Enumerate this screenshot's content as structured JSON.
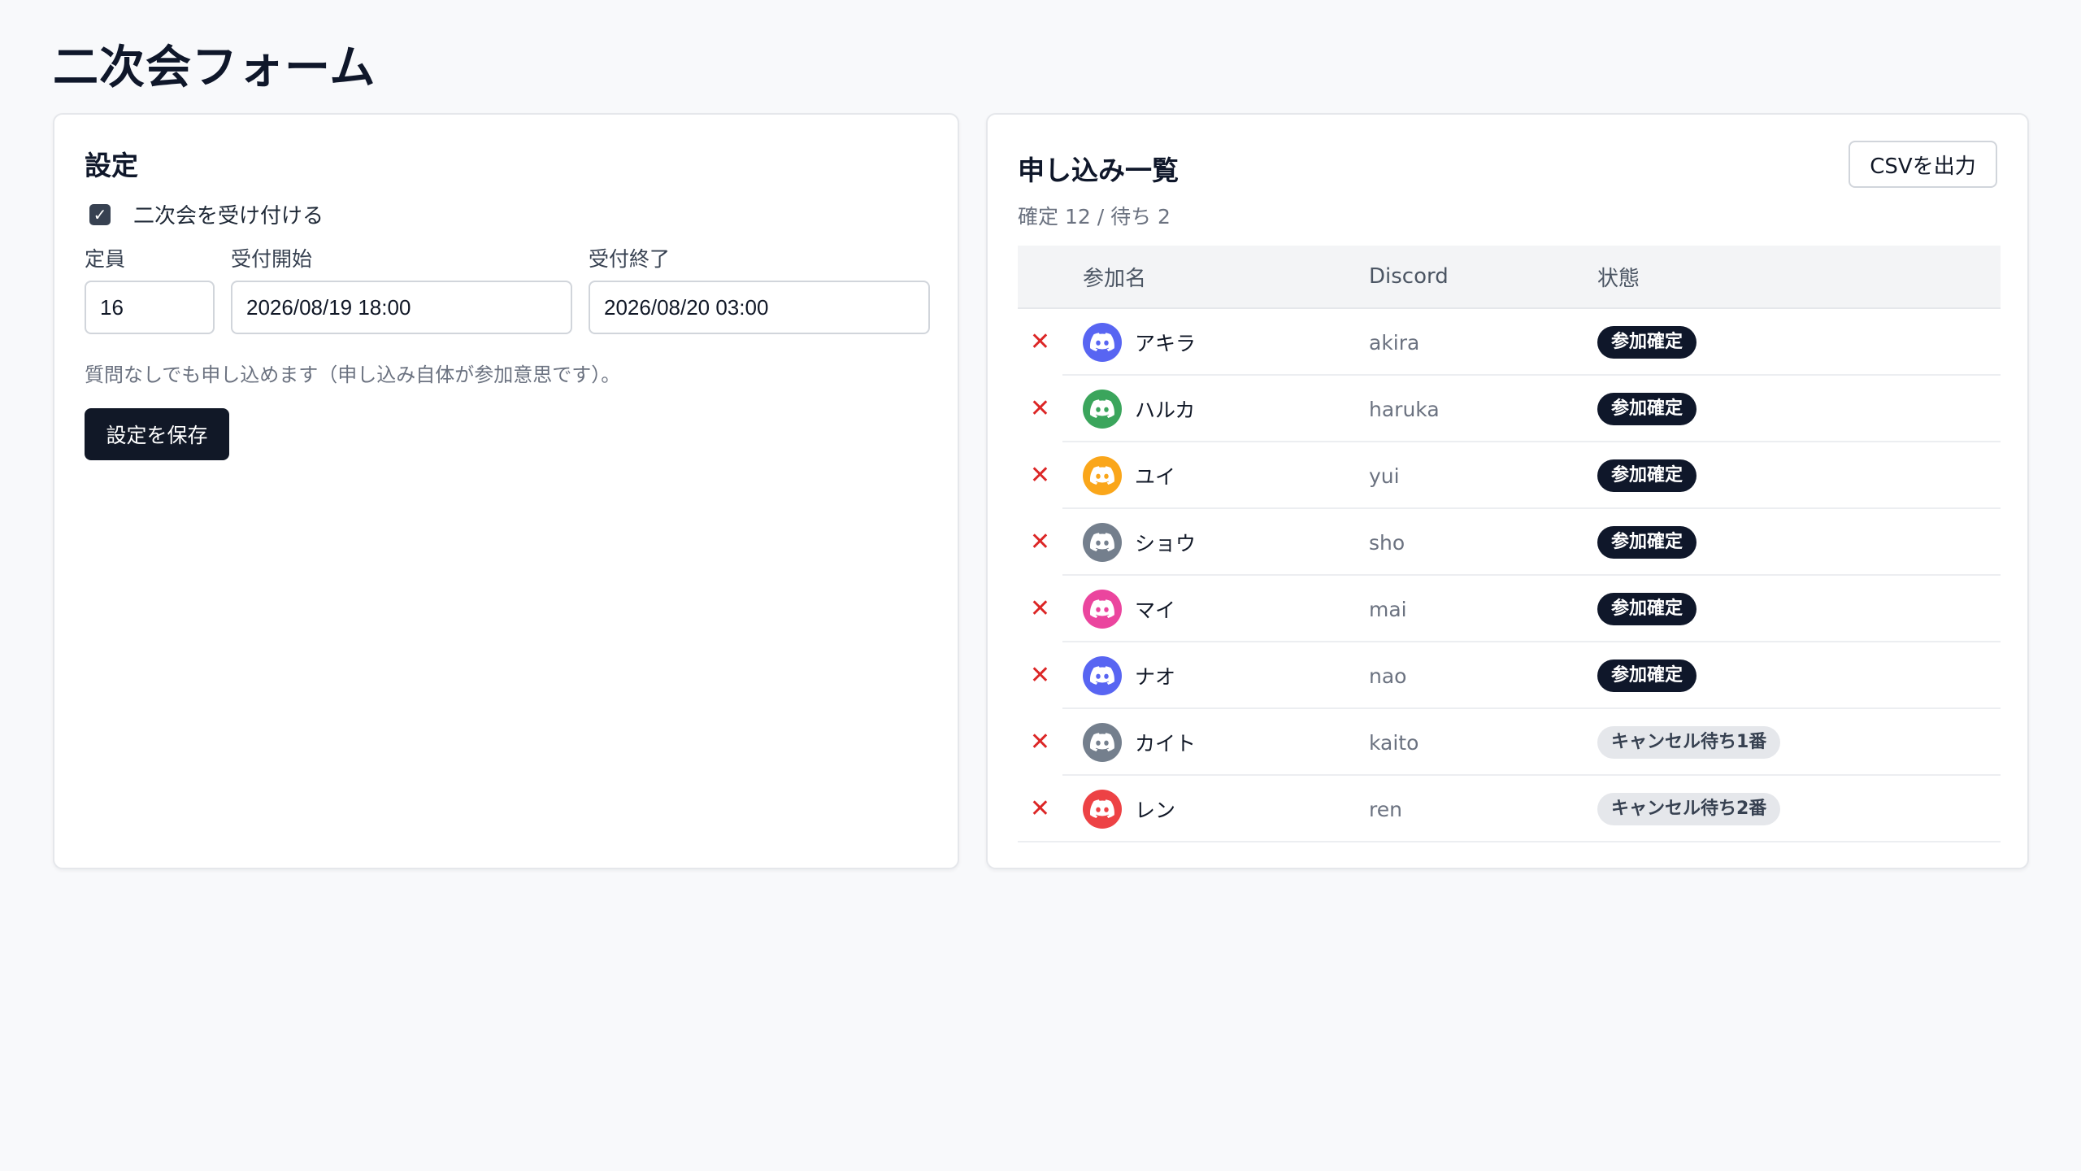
{
  "page": {
    "title": "二次会フォーム"
  },
  "settings": {
    "heading": "設定",
    "accept_label": "二次会を受け付ける",
    "accept_checked": true,
    "capacity_label": "定員",
    "capacity_value": "16",
    "start_label": "受付開始",
    "start_value": "2026/08/19 18:00",
    "end_label": "受付終了",
    "end_value": "2026/08/20 03:00",
    "note": "質問なしでも申し込めます（申し込み自体が参加意思です）。",
    "save_label": "設定を保存"
  },
  "list": {
    "heading": "申し込み一覧",
    "csv_label": "CSVを出力",
    "summary": "確定 12 / 待ち 2",
    "columns": {
      "name": "参加名",
      "discord": "Discord",
      "status": "状態"
    },
    "rows": [
      {
        "name": "アキラ",
        "discord": "akira",
        "status": "参加確定",
        "kind": "confirmed",
        "avatar_color": "#5865f2"
      },
      {
        "name": "ハルカ",
        "discord": "haruka",
        "status": "参加確定",
        "kind": "confirmed",
        "avatar_color": "#3ba55c"
      },
      {
        "name": "ユイ",
        "discord": "yui",
        "status": "参加確定",
        "kind": "confirmed",
        "avatar_color": "#faa61a"
      },
      {
        "name": "ショウ",
        "discord": "sho",
        "status": "参加確定",
        "kind": "confirmed",
        "avatar_color": "#747f8d"
      },
      {
        "name": "マイ",
        "discord": "mai",
        "status": "参加確定",
        "kind": "confirmed",
        "avatar_color": "#eb459e"
      },
      {
        "name": "ナオ",
        "discord": "nao",
        "status": "参加確定",
        "kind": "confirmed",
        "avatar_color": "#5865f2"
      },
      {
        "name": "カイト",
        "discord": "kaito",
        "status": "キャンセル待ち1番",
        "kind": "waitlist",
        "avatar_color": "#747f8d"
      },
      {
        "name": "レン",
        "discord": "ren",
        "status": "キャンセル待ち2番",
        "kind": "waitlist",
        "avatar_color": "#ed4245"
      }
    ]
  },
  "icons": {
    "check": "check-icon",
    "remove": "x-icon",
    "avatar": "discord-icon"
  }
}
